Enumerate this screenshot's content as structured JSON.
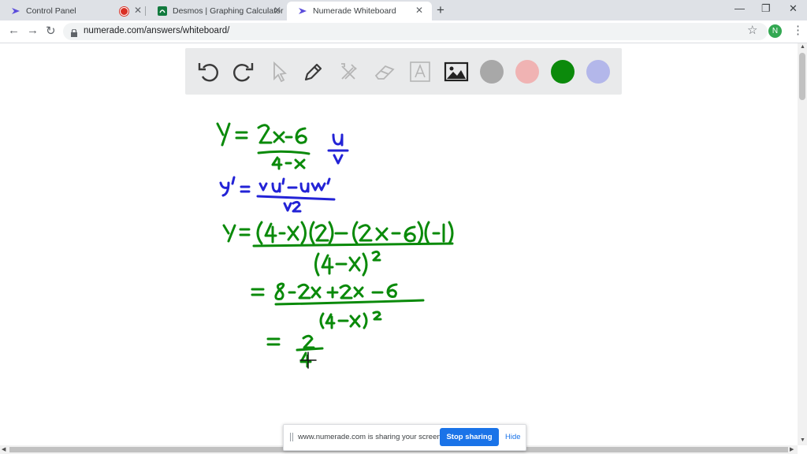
{
  "browser": {
    "tabs": [
      {
        "title": "Control Panel",
        "recording": true
      },
      {
        "title": "Desmos | Graphing Calculator"
      },
      {
        "title": "Numerade Whiteboard",
        "active": true
      }
    ],
    "new_tab": "+",
    "window_controls": {
      "minimize": "—",
      "restore": "❐",
      "close": "✕"
    },
    "url": "numerade.com/answers/whiteboard/",
    "profile_initial": "N"
  },
  "whiteboard": {
    "tools": [
      "undo-icon",
      "redo-icon",
      "pointer-icon",
      "pen-icon",
      "tools-icon",
      "eraser-icon",
      "text-icon",
      "image-icon"
    ],
    "colors": [
      "#a8a8a8",
      "#f0b3b3",
      "#0b8a0b",
      "#b3b7ea"
    ]
  },
  "notes": {
    "line1": {
      "lhs": "y =",
      "num": "2x-6",
      "den": "4-x",
      "uv_num": "u",
      "uv_den": "v"
    },
    "line2": {
      "lhs": "y' =",
      "num": "vu' - uv'",
      "den": "v²"
    },
    "line3": {
      "lhs": "y =",
      "num": "(4-x)(2) - (2x-6)(-1)",
      "den": "(4-x)²"
    },
    "line4": {
      "lhs": "=",
      "num": "8-2x+2x-6",
      "den": "(4-x)²"
    },
    "line5": {
      "lhs": "=",
      "num": "2",
      "den": "4"
    }
  },
  "share_bar": {
    "message": "www.numerade.com is sharing your screen.",
    "stop_label": "Stop sharing",
    "hide_label": "Hide"
  }
}
